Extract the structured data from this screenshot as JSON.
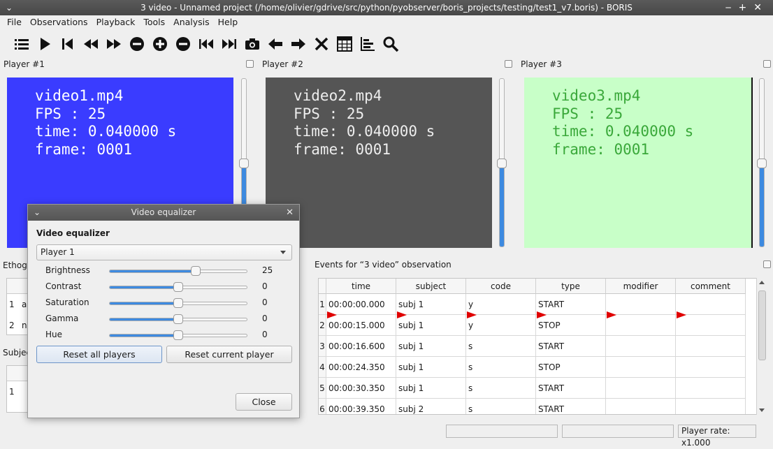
{
  "window": {
    "title": "3 video - Unnamed project (/home/olivier/gdrive/src/python/pyobserver/boris_projects/testing/test1_v7.boris) - BORIS"
  },
  "menu": [
    "File",
    "Observations",
    "Playback",
    "Tools",
    "Analysis",
    "Help"
  ],
  "toolbar": {
    "icons": [
      "list-icon",
      "play-icon",
      "jump-start-icon",
      "rewind-icon",
      "fast-forward-icon",
      "slower-icon",
      "faster-icon",
      "reset-speed-icon",
      "previous-media-icon",
      "next-media-icon",
      "snapshot-icon",
      "frame-back-icon",
      "frame-forward-icon",
      "close-icon",
      "table-icon",
      "plot-icon",
      "search-icon"
    ]
  },
  "players": [
    {
      "header": "Player #1",
      "line1": "video1.mp4",
      "line2": "FPS : 25",
      "line3": "time: 0.040000 s",
      "line4": "frame: 0001",
      "bg": "#3a3cff"
    },
    {
      "header": "Player #2",
      "line1": "video2.mp4",
      "line2": "FPS : 25",
      "line3": "time: 0.040000 s",
      "line4": "frame: 0001",
      "bg": "#555555"
    },
    {
      "header": "Player #3",
      "line1": "video3.mp4",
      "line2": "FPS : 25",
      "line3": "time: 0.040000 s",
      "line4": "frame: 0001",
      "bg": "#c8ffc8"
    }
  ],
  "left_docks": {
    "ethogram_label": "Ethogr",
    "ethogram_row1_num": "1",
    "ethogram_row1_text": "a",
    "ethogram_row2_num": "2",
    "ethogram_row2_text": "n",
    "subjects_label": "Subjec",
    "subjects_row1_num": "1"
  },
  "events": {
    "title": "Events for “3 video” observation",
    "columns": [
      "time",
      "subject",
      "code",
      "type",
      "modifier",
      "comment"
    ],
    "rows": [
      {
        "n": "1",
        "time": "00:00:00.000",
        "subject": "subj 1",
        "code": "y",
        "type": "START",
        "modifier": "",
        "comment": ""
      },
      {
        "n": "2",
        "time": "00:00:15.000",
        "subject": "subj 1",
        "code": "y",
        "type": "STOP",
        "modifier": "",
        "comment": ""
      },
      {
        "n": "3",
        "time": "00:00:16.600",
        "subject": "subj 1",
        "code": "s",
        "type": "START",
        "modifier": "",
        "comment": ""
      },
      {
        "n": "4",
        "time": "00:00:24.350",
        "subject": "subj 1",
        "code": "s",
        "type": "STOP",
        "modifier": "",
        "comment": ""
      },
      {
        "n": "5",
        "time": "00:00:30.350",
        "subject": "subj 1",
        "code": "s",
        "type": "START",
        "modifier": "",
        "comment": ""
      },
      {
        "n": "6",
        "time": "00:00:39.350",
        "subject": "subj 2",
        "code": "s",
        "type": "START",
        "modifier": "",
        "comment": ""
      }
    ]
  },
  "status": {
    "box1": "",
    "box2": "",
    "player_rate": "Player rate: x1.000"
  },
  "equalizer": {
    "title": "Video equalizer",
    "heading": "Video equalizer",
    "selected_player": "Player 1",
    "params": [
      {
        "label": "Brightness",
        "value": "25",
        "fraction": 0.625
      },
      {
        "label": "Contrast",
        "value": "0",
        "fraction": 0.5
      },
      {
        "label": "Saturation",
        "value": "0",
        "fraction": 0.5
      },
      {
        "label": "Gamma",
        "value": "0",
        "fraction": 0.5
      },
      {
        "label": "Hue",
        "value": "0",
        "fraction": 0.5
      }
    ],
    "reset_all_label": "Reset all players",
    "reset_current_label": "Reset current player",
    "close_label": "Close"
  },
  "colors": {
    "accent": "#3d8ae0",
    "current_event_marker": "#e00000"
  }
}
